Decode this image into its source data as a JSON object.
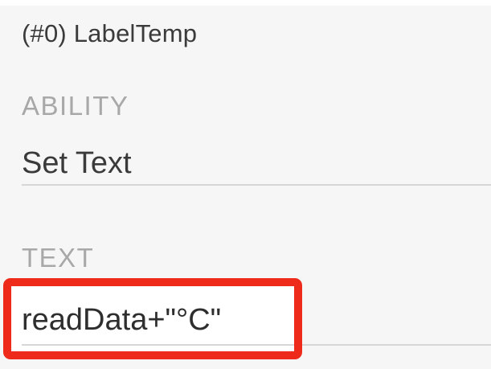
{
  "block": {
    "title": "(#0) LabelTemp"
  },
  "fields": {
    "ability": {
      "label": "ABILITY",
      "value": "Set Text"
    },
    "text": {
      "label": "TEXT",
      "value": "readData+\"°C\""
    }
  },
  "colors": {
    "highlight": "#ee2a1b",
    "label_gray": "#a8a8a8",
    "panel_bg": "#f6f6f6"
  }
}
